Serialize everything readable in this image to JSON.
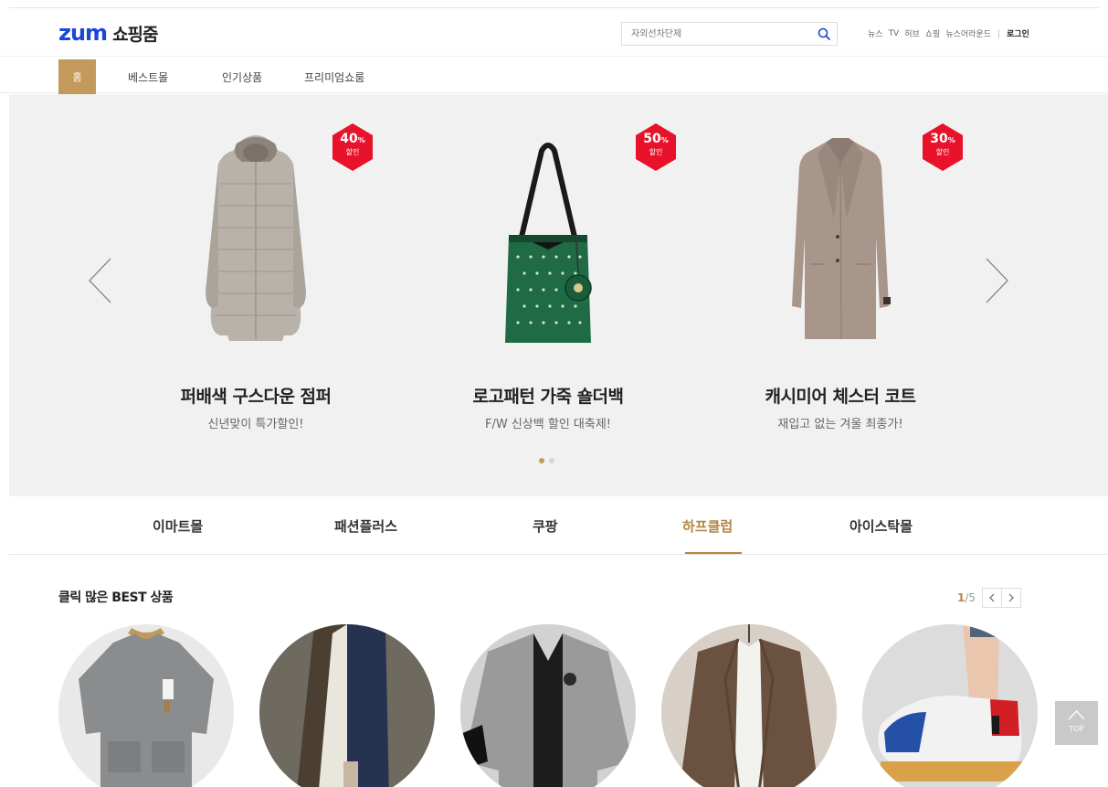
{
  "header": {
    "logo_text": "zum",
    "logo_sub": "쇼핑줌",
    "search_placeholder": "자외선차단제",
    "gnb": [
      "뉴스",
      "TV",
      "허브",
      "쇼핑",
      "뉴스어라운드"
    ],
    "login": "로그인"
  },
  "nav": {
    "home": "홈",
    "items": [
      "베스트몰",
      "인기상품",
      "프리미엄쇼룸"
    ]
  },
  "hero": {
    "slides": [
      {
        "title": "퍼배색 구스다운 점퍼",
        "subtitle": "신년맞이 특가할인!",
        "discount": "40",
        "discount_unit": "%",
        "discount_label": "할인"
      },
      {
        "title": "로고패턴 가죽 숄더백",
        "subtitle": "F/W 신상백 할인 대축제!",
        "discount": "50",
        "discount_unit": "%",
        "discount_label": "할인"
      },
      {
        "title": "캐시미어 체스터 코트",
        "subtitle": "재입고 없는 겨울 최종가!",
        "discount": "30",
        "discount_unit": "%",
        "discount_label": "할인"
      }
    ],
    "active_dot": 0,
    "dot_count": 2
  },
  "malls": {
    "items": [
      "이마트몰",
      "패션플러스",
      "쿠팡",
      "하프클럽",
      "아이스탁몰"
    ],
    "active": "하프클럽"
  },
  "best": {
    "title": "클릭 많은 BEST 상품",
    "page_current": "1",
    "page_total": "/5"
  },
  "top_button": "TOP",
  "colors": {
    "brand_blue": "#1a47d8",
    "accent_gold": "#c49a5c",
    "badge_red": "#e8122a",
    "hero_bg": "#f1f1f1"
  }
}
